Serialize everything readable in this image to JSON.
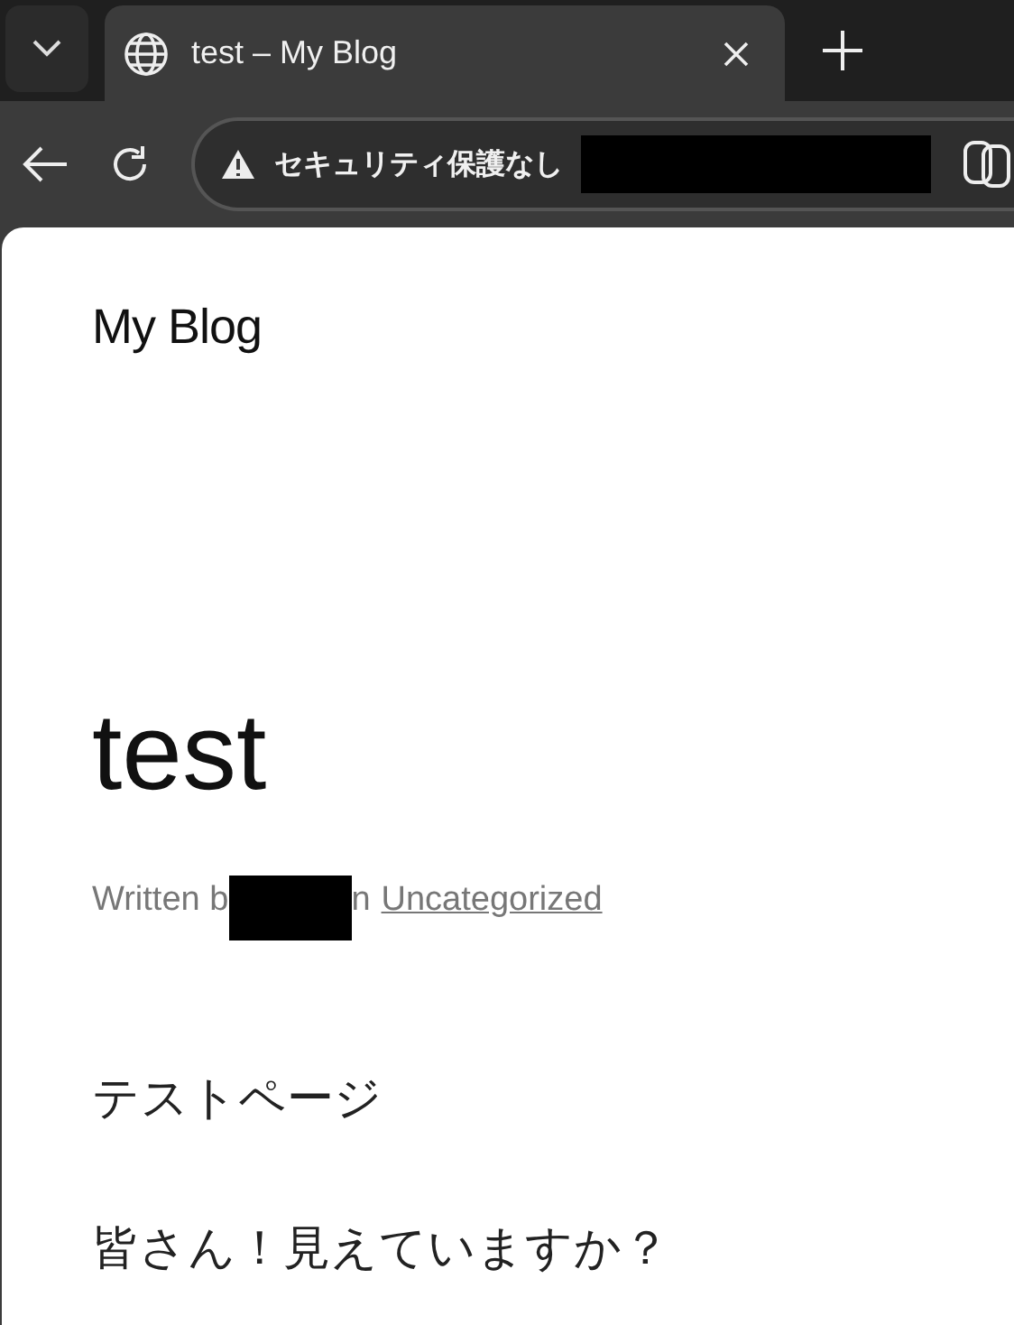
{
  "browser": {
    "tab": {
      "title": "test – My Blog",
      "selected": true
    },
    "security_label": "セキュリティ保護なし"
  },
  "page": {
    "site_title": "My Blog",
    "post_title": "test",
    "meta": {
      "before": "Written b",
      "after": "n",
      "category": "Uncategorized"
    },
    "paragraphs": [
      "テストページ",
      "皆さん！見えていますか？"
    ]
  }
}
